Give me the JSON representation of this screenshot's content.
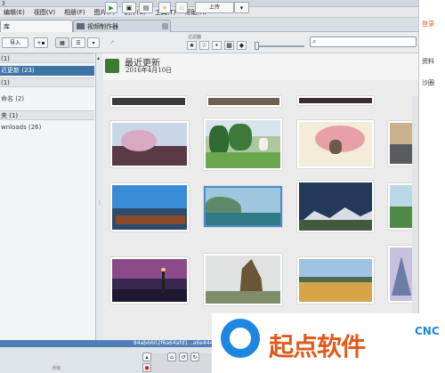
{
  "window": {
    "title_fragment": "3"
  },
  "menu": [
    "编辑(E)",
    "视图(V)",
    "相册(F)",
    "图片(P)",
    "制作(C)",
    "工具(T)",
    "帮助(H)"
  ],
  "tabs": [
    {
      "label": "库"
    },
    {
      "label": "视频制作器"
    }
  ],
  "toolbar": {
    "import_label": "导入",
    "filter_label": "过滤器",
    "star_filters": [
      "★",
      "☆",
      "👤",
      "▦",
      "▪",
      "▸"
    ]
  },
  "left_panel": {
    "rows": [
      {
        "label": "(1)"
      },
      {
        "label": "近更新 (23)"
      },
      {
        "label": "(1)"
      },
      {
        "label": "命名 (2)"
      },
      {
        "label": "夹 (1)"
      },
      {
        "label": "wnloads (26)"
      }
    ]
  },
  "main": {
    "title": "最近更新",
    "date": "2016年4月10日",
    "upload_label": "上传"
  },
  "right_overlay": {
    "items": [
      "登录",
      "资料",
      "沙圈"
    ]
  },
  "bottom": {
    "filename": "84ab6602f6a64afd1...a6e4445.jpg",
    "footer_label": "通缩"
  },
  "watermark": {
    "brand": "起点软件",
    "brand_suffix": "CNC"
  },
  "colors": {
    "selection": "#3d74a6",
    "selected_thumb_border": "#4f8cc8",
    "logo_blue": "#1e86e0",
    "logo_orange": "#e05a1c"
  }
}
